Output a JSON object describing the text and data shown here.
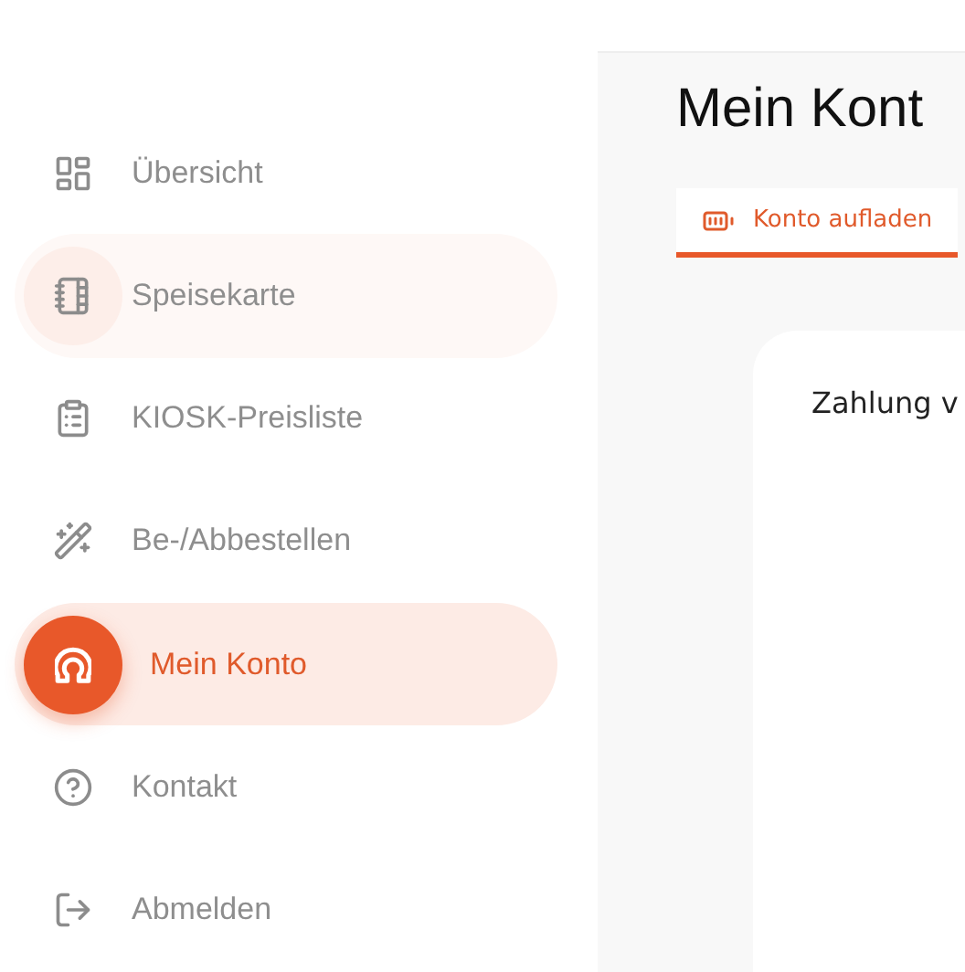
{
  "sidebar": {
    "items": [
      {
        "label": "Übersicht",
        "selected": false,
        "hovered": false
      },
      {
        "label": "Speisekarte",
        "selected": false,
        "hovered": true
      },
      {
        "label": "KIOSK-Preisliste",
        "selected": false,
        "hovered": false
      },
      {
        "label": "Be-/Abbestellen",
        "selected": false,
        "hovered": false
      },
      {
        "label": "Mein Konto",
        "selected": true,
        "hovered": false
      },
      {
        "label": "Kontakt",
        "selected": false,
        "hovered": false
      },
      {
        "label": "Abmelden",
        "selected": false,
        "hovered": false
      }
    ]
  },
  "main": {
    "title": "Mein Kont",
    "tabs": [
      {
        "label": "Konto aufladen",
        "selected": true
      }
    ],
    "card": {
      "heading": "Zahlung v"
    }
  }
}
